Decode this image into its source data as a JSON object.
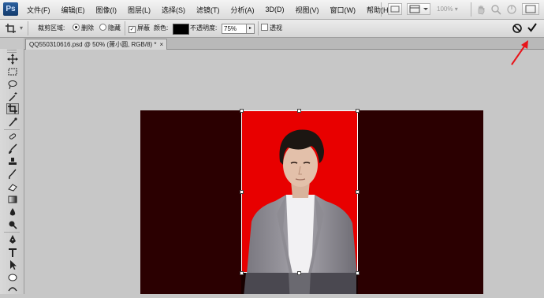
{
  "app": {
    "logo": "Ps"
  },
  "menubar": {
    "items": [
      "文件(F)",
      "编辑(E)",
      "图像(I)",
      "图层(L)",
      "选择(S)",
      "滤镜(T)",
      "分析(A)",
      "3D(D)",
      "视图(V)",
      "窗口(W)",
      "帮助(H)"
    ],
    "zoom": "100%"
  },
  "options_bar": {
    "crop_area_label": "裁剪区域:",
    "delete_label": "删除",
    "hide_label": "隐藏",
    "shield_label": "屏蔽",
    "color_label": "颜色:",
    "opacity_label": "不透明度:",
    "opacity_value": "75%",
    "perspective_label": "透视",
    "shield_color": "#000000"
  },
  "document_tab": {
    "title": "QQ550310616.psd @ 50% (萧小圆, RGB/8) *",
    "close": "×"
  },
  "colors": {
    "crop_fill": "#e80000",
    "canvas_bg": "#2b0001",
    "annotation": "#e8141a"
  },
  "toolbox": {
    "tools": [
      "move-icon",
      "marquee-icon",
      "lasso-icon",
      "magic-wand-icon",
      "crop-icon",
      "eyedropper-icon",
      "healing-brush-icon",
      "brush-icon",
      "clone-stamp-icon",
      "history-brush-icon",
      "eraser-icon",
      "gradient-icon",
      "blur-icon",
      "dodge-icon",
      "pen-icon",
      "type-icon",
      "path-selection-icon",
      "shape-icon",
      "3d-rotate-icon"
    ]
  }
}
